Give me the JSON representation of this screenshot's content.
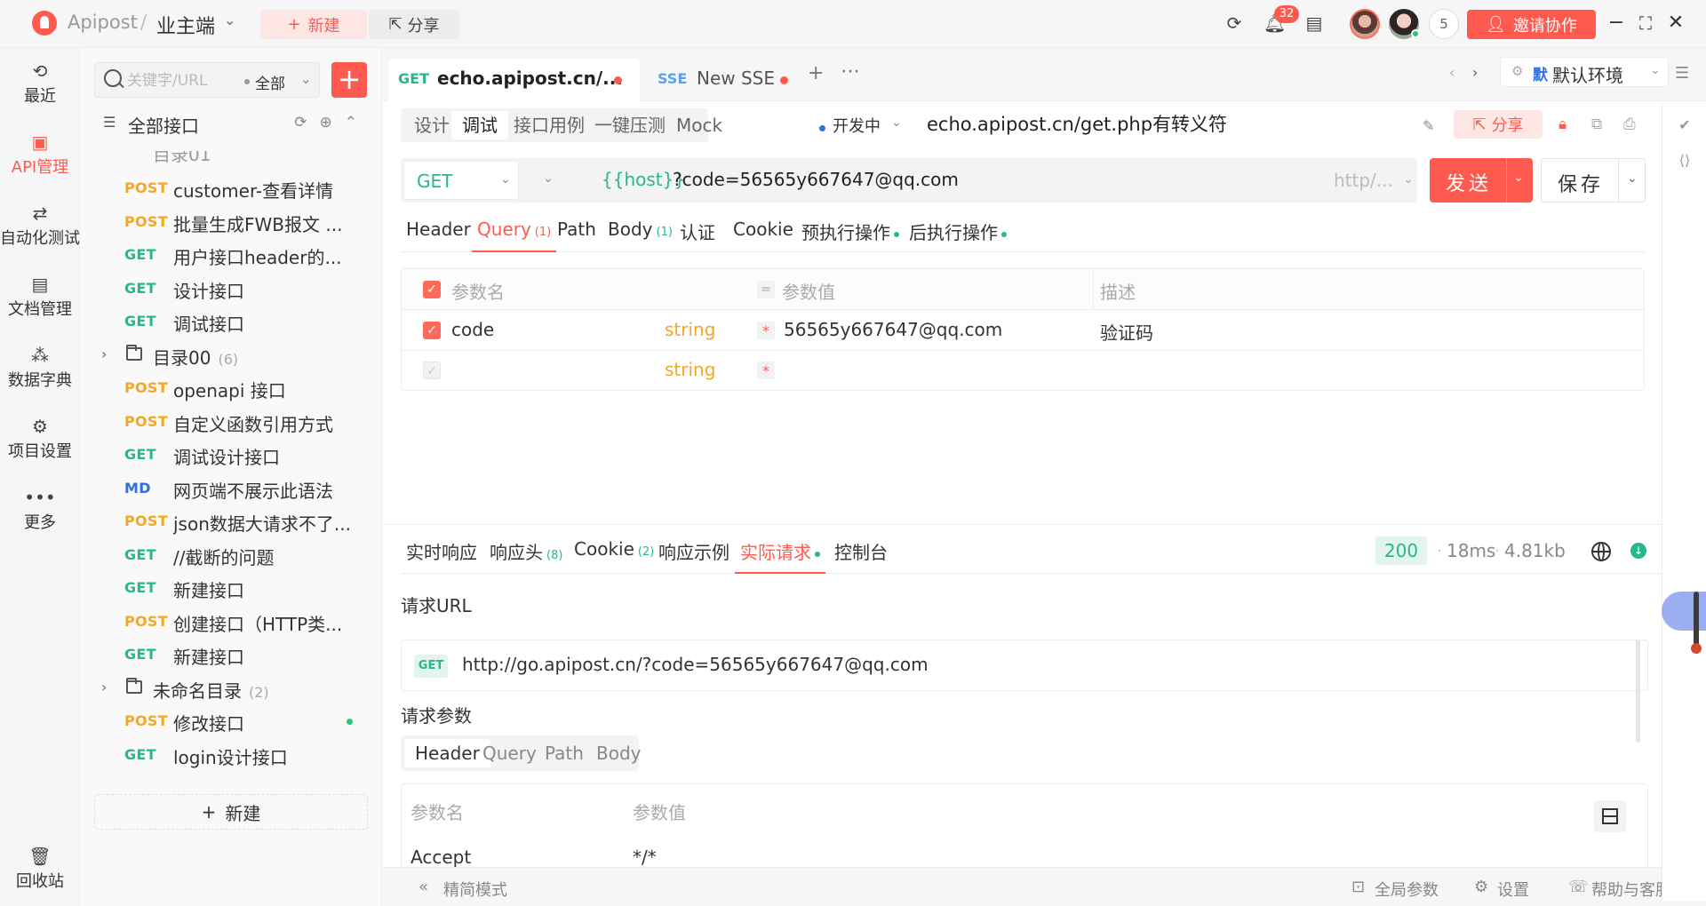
{
  "topbar": {
    "app_name": "Apipost",
    "separator": "/",
    "project": "业主端",
    "new_label": "新建",
    "share_label": "分享",
    "notification_count": "32",
    "member_count": "5",
    "invite_label": "邀请协作"
  },
  "leftnav": {
    "items": [
      {
        "label": "最近",
        "icon": "history-icon"
      },
      {
        "label": "API管理",
        "icon": "api-icon"
      },
      {
        "label": "自动化测试",
        "icon": "flow-icon"
      },
      {
        "label": "文档管理",
        "icon": "doc-icon"
      },
      {
        "label": "数据字典",
        "icon": "dict-icon"
      },
      {
        "label": "项目设置",
        "icon": "settings-icon"
      },
      {
        "label": "更多",
        "icon": "more-icon"
      }
    ],
    "trash_label": "回收站"
  },
  "tree": {
    "search_placeholder": "关键字/URL",
    "scope": "全部",
    "title": "全部接口",
    "partial_row": "目录01",
    "new_label": "新建",
    "rows": [
      {
        "type": "api",
        "method": "POST",
        "name": "customer-查看详情"
      },
      {
        "type": "api",
        "method": "POST",
        "name": "批量生成FWB报文 ..."
      },
      {
        "type": "api",
        "method": "GET",
        "name": "用户接口header的..."
      },
      {
        "type": "api",
        "method": "GET",
        "name": "设计接口"
      },
      {
        "type": "api",
        "method": "GET",
        "name": "调试接口"
      },
      {
        "type": "folder",
        "name": "目录00",
        "count": "(6)"
      },
      {
        "type": "api",
        "method": "POST",
        "name": "openapi 接口"
      },
      {
        "type": "api",
        "method": "POST",
        "name": "自定义函数引用方式"
      },
      {
        "type": "api",
        "method": "GET",
        "name": "调试设计接口"
      },
      {
        "type": "api",
        "method": "MD",
        "name": "网页端不展示此语法"
      },
      {
        "type": "api",
        "method": "POST",
        "name": "json数据大请求不了..."
      },
      {
        "type": "api",
        "method": "GET",
        "name": "//截断的问题"
      },
      {
        "type": "api",
        "method": "GET",
        "name": "新建接口"
      },
      {
        "type": "api",
        "method": "POST",
        "name": "创建接口（HTTP类..."
      },
      {
        "type": "api",
        "method": "GET",
        "name": "新建接口"
      },
      {
        "type": "folder",
        "name": "未命名目录",
        "count": "(2)"
      },
      {
        "type": "api",
        "method": "POST",
        "name": "修改接口",
        "dot": true
      },
      {
        "type": "api",
        "method": "GET",
        "name": "login设计接口"
      }
    ]
  },
  "tabs": {
    "items": [
      {
        "method": "GET",
        "title": "echo.apipost.cn/..."
      },
      {
        "method": "SSE",
        "title": "New SSE"
      }
    ],
    "env_tag": "默",
    "env_name": "默认环境"
  },
  "editor": {
    "subtabs": [
      "设计",
      "调试",
      "接口用例",
      "一键压测",
      "Mock"
    ],
    "active_subtab": "调试",
    "status": "开发中",
    "api_title": "echo.apipost.cn/get.php有转义符",
    "share_label": "分享"
  },
  "urlbar": {
    "method": "GET",
    "host": "{{host}}",
    "path": "?code=56565y667647@qq.com",
    "protocol": "http/...",
    "send_label": "发送",
    "save_label": "保存"
  },
  "request_tabs": [
    {
      "label": "Header",
      "count": ""
    },
    {
      "label": "Query",
      "count": "(1)",
      "active": true
    },
    {
      "label": "Path",
      "count": ""
    },
    {
      "label": "Body",
      "count": "(1)"
    },
    {
      "label": "认证",
      "count": ""
    },
    {
      "label": "Cookie",
      "count": ""
    },
    {
      "label": "预执行操作",
      "count": "",
      "dot": true
    },
    {
      "label": "后执行操作",
      "count": "",
      "dot": true
    }
  ],
  "params": {
    "headers": {
      "name": "参数名",
      "value": "参数值",
      "desc": "描述"
    },
    "rows": [
      {
        "name": "code",
        "type": "string",
        "value": "56565y667647@qq.com",
        "desc": "验证码",
        "checked": true
      },
      {
        "name": "",
        "type": "string",
        "value": "",
        "desc": "",
        "checked": false
      }
    ]
  },
  "response": {
    "tabs": [
      {
        "label": "实时响应",
        "count": ""
      },
      {
        "label": "响应头",
        "count": "(8)"
      },
      {
        "label": "Cookie",
        "count": "(2)"
      },
      {
        "label": "响应示例",
        "count": ""
      },
      {
        "label": "实际请求",
        "count": "",
        "active": true,
        "dot": true
      },
      {
        "label": "控制台",
        "count": ""
      }
    ],
    "status_code": "200",
    "time": "18ms",
    "size": "4.81kb",
    "request_url_label": "请求URL",
    "request_method": "GET",
    "request_url": "http://go.apipost.cn/?code=56565y667647@qq.com",
    "request_params_label": "请求参数",
    "param_tabs": [
      "Header",
      "Query",
      "Path",
      "Body"
    ],
    "active_param_tab": "Header",
    "table_headers": {
      "name": "参数名",
      "value": "参数值"
    },
    "first_row": {
      "name": "Accept",
      "value": "*/*"
    }
  },
  "footer": {
    "simple_mode": "精简模式",
    "global_params": "全局参数",
    "settings": "设置",
    "help": "帮助与客服"
  },
  "colors": {
    "accent": "#ff5a50",
    "get": "#28b78d",
    "post": "#f5a623",
    "md": "#2f6fe0"
  }
}
